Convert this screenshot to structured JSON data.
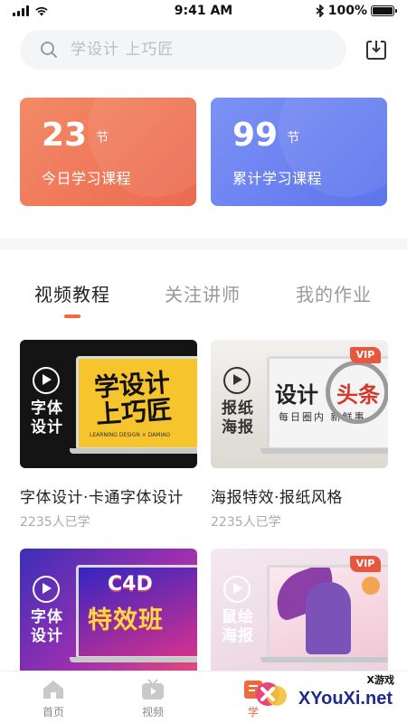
{
  "status_bar": {
    "time": "9:41 AM",
    "battery": "100%"
  },
  "search": {
    "placeholder": "学设计 上巧匠"
  },
  "stats": [
    {
      "value": "23",
      "unit": "节",
      "label": "今日学习课程",
      "color": "#ec6a4f"
    },
    {
      "value": "99",
      "unit": "节",
      "label": "累计学习课程",
      "color": "#5c74ec"
    }
  ],
  "tabs": [
    {
      "label": "视频教程",
      "active": true
    },
    {
      "label": "关注讲师",
      "active": false
    },
    {
      "label": "我的作业",
      "active": false
    }
  ],
  "courses": [
    {
      "title": "字体设计·卡通字体设计",
      "learners": "2235人已学",
      "tag_line1": "字体",
      "tag_line2": "设计",
      "screen_title": "学设计上巧匠",
      "screen_sub": "LEARNING DESIGN × DAMIAO",
      "vip": false
    },
    {
      "title": "海报特效·报纸风格",
      "learners": "2235人已学",
      "tag_line1": "报纸",
      "tag_line2": "海报",
      "screen_title_1": "设计",
      "screen_title_2": "头条",
      "screen_sub": "每日圈内 新鲜事",
      "vip": true,
      "vip_label": "VIP"
    },
    {
      "tag_line1": "字体",
      "tag_line2": "设计",
      "screen_title_1": "C4D",
      "screen_title_2": "特效班",
      "vip": false
    },
    {
      "tag_line1": "鼠绘",
      "tag_line2": "海报",
      "vip": true,
      "vip_label": "VIP"
    }
  ],
  "bottom_nav": [
    {
      "label": "首页",
      "icon": "home-icon"
    },
    {
      "label": "视频",
      "icon": "tv-icon"
    },
    {
      "label": "学",
      "icon": "learn-icon",
      "active": true
    }
  ],
  "watermark": {
    "top": "X游戏",
    "main": "XYouXi.net"
  },
  "colors": {
    "accent": "#f0683c",
    "orange_card": "#ec6a4f",
    "blue_card": "#5c74ec",
    "vip": "#e9563e"
  }
}
